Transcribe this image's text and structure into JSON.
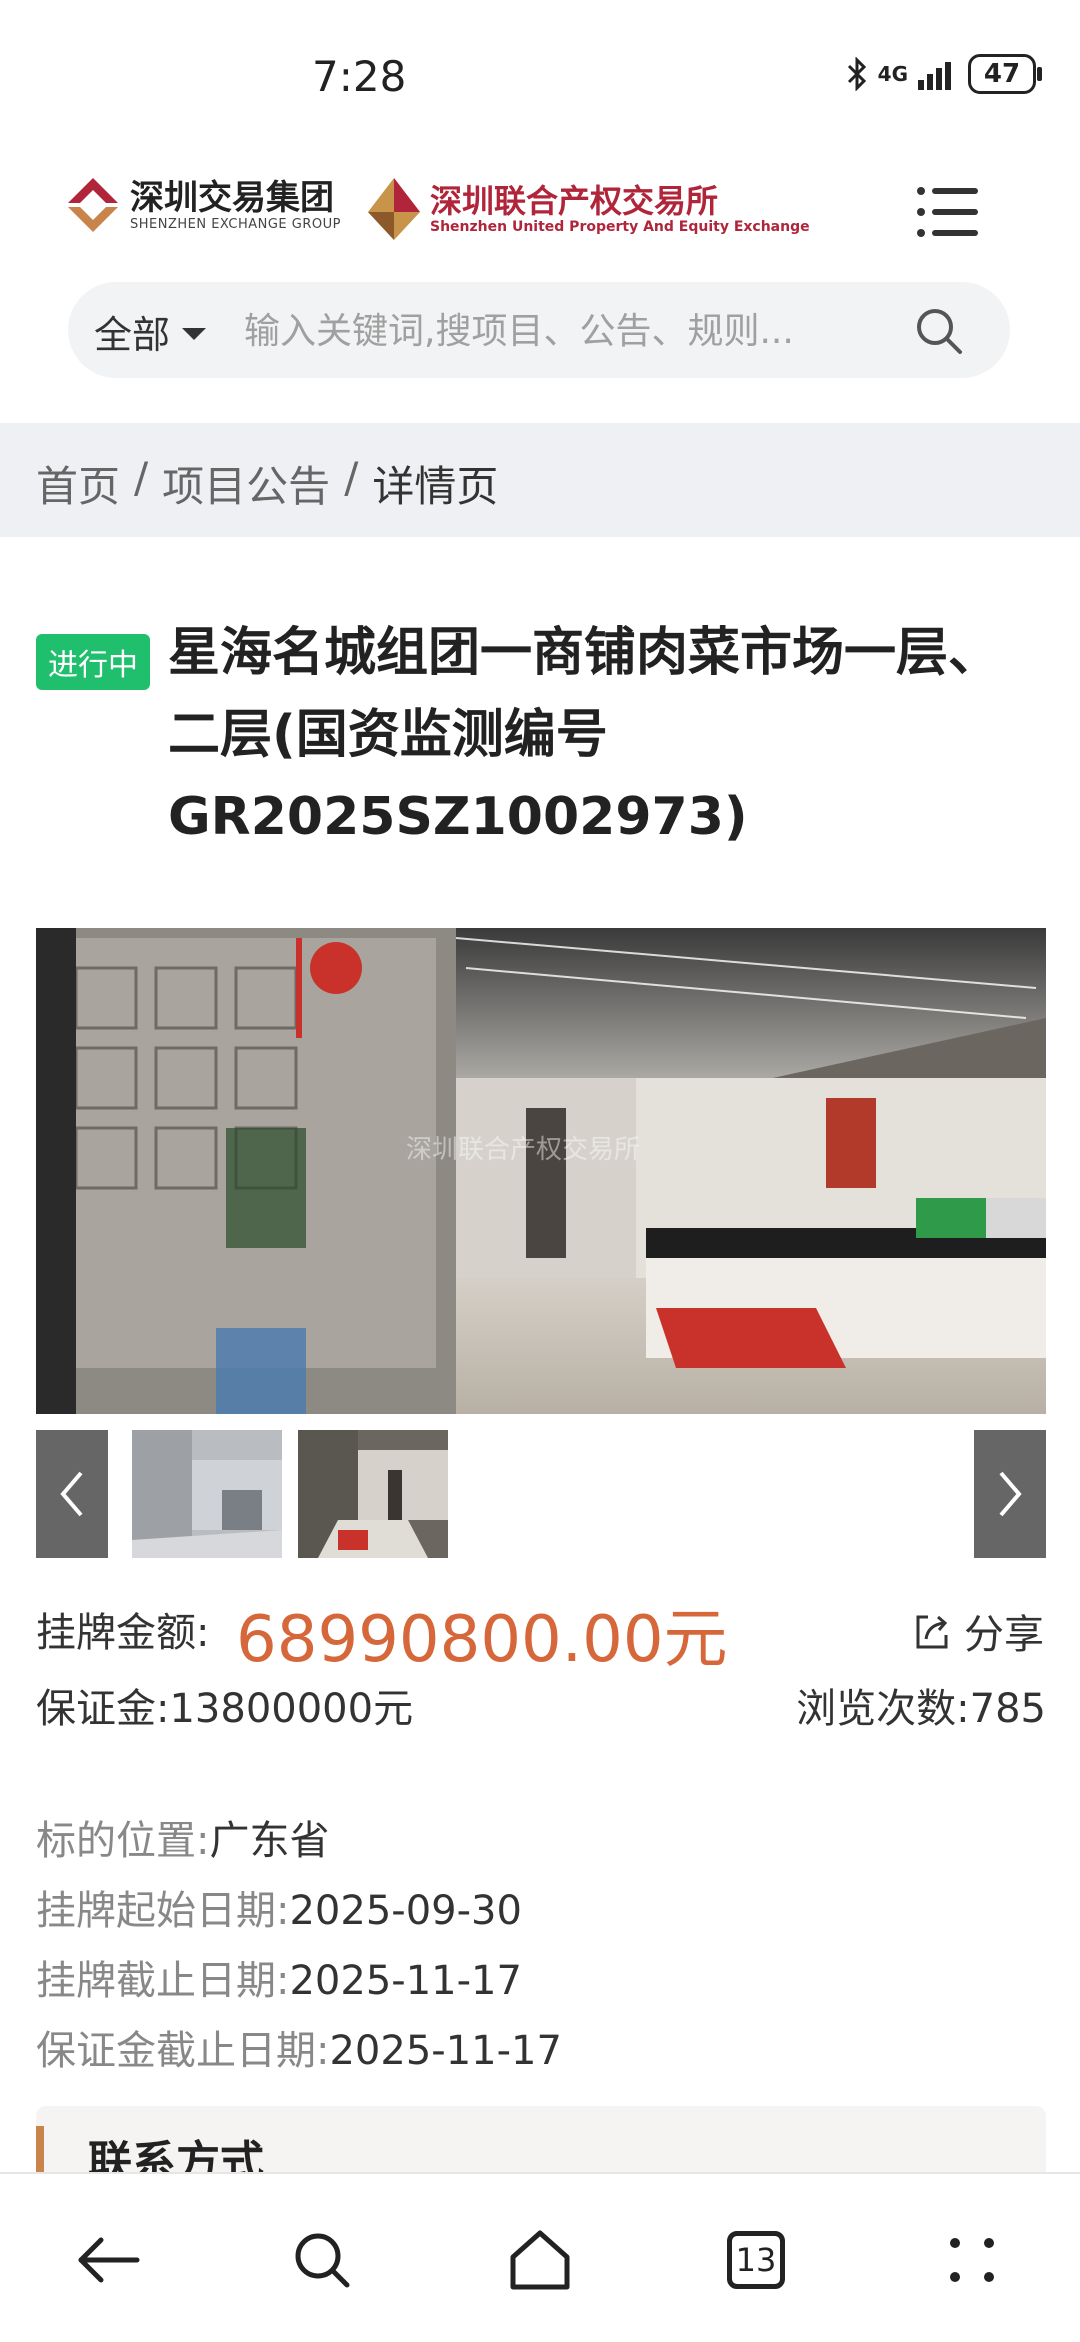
{
  "status_bar": {
    "time": "7:28",
    "network": "4G",
    "battery": "47"
  },
  "header": {
    "logo1_cn": "深圳交易集团",
    "logo1_en": "SHENZHEN EXCHANGE GROUP",
    "logo2_cn": "深圳联合产权交易所",
    "logo2_en": "Shenzhen United Property And Equity Exchange"
  },
  "search": {
    "scope": "全部",
    "placeholder": "输入关键词,搜项目、公告、规则..."
  },
  "breadcrumb": {
    "home": "首页",
    "sep": "/",
    "section": "项目公告",
    "current": "详情页"
  },
  "project": {
    "status": "进行中",
    "title": "星海名城组团一商铺肉菜市场一层、二层(国资监测编号GR2025SZ1002973)",
    "image_watermark": "深圳联合产权交易所"
  },
  "pricing": {
    "price_label": "挂牌金额:",
    "price_value": "68990800.00元",
    "share_label": "分享",
    "deposit_label": "保证金:",
    "deposit_value": "13800000元",
    "views_label": "浏览次数:",
    "views_value": "785"
  },
  "details": {
    "location_label": "标的位置:",
    "location_value": "广东省",
    "start_label": "挂牌起始日期:",
    "start_value": "2025-09-30",
    "end_label": "挂牌截止日期:",
    "end_value": "2025-11-17",
    "deposit_end_label": "保证金截止日期:",
    "deposit_end_value": "2025-11-17"
  },
  "contact": {
    "label": "联系方式"
  },
  "bottom_nav": {
    "tab_count": "13"
  },
  "colors": {
    "status_green": "#1fbf6e",
    "price_orange": "#d6673b",
    "brand_red": "#b0253a",
    "accent_bar": "#c8844a"
  }
}
